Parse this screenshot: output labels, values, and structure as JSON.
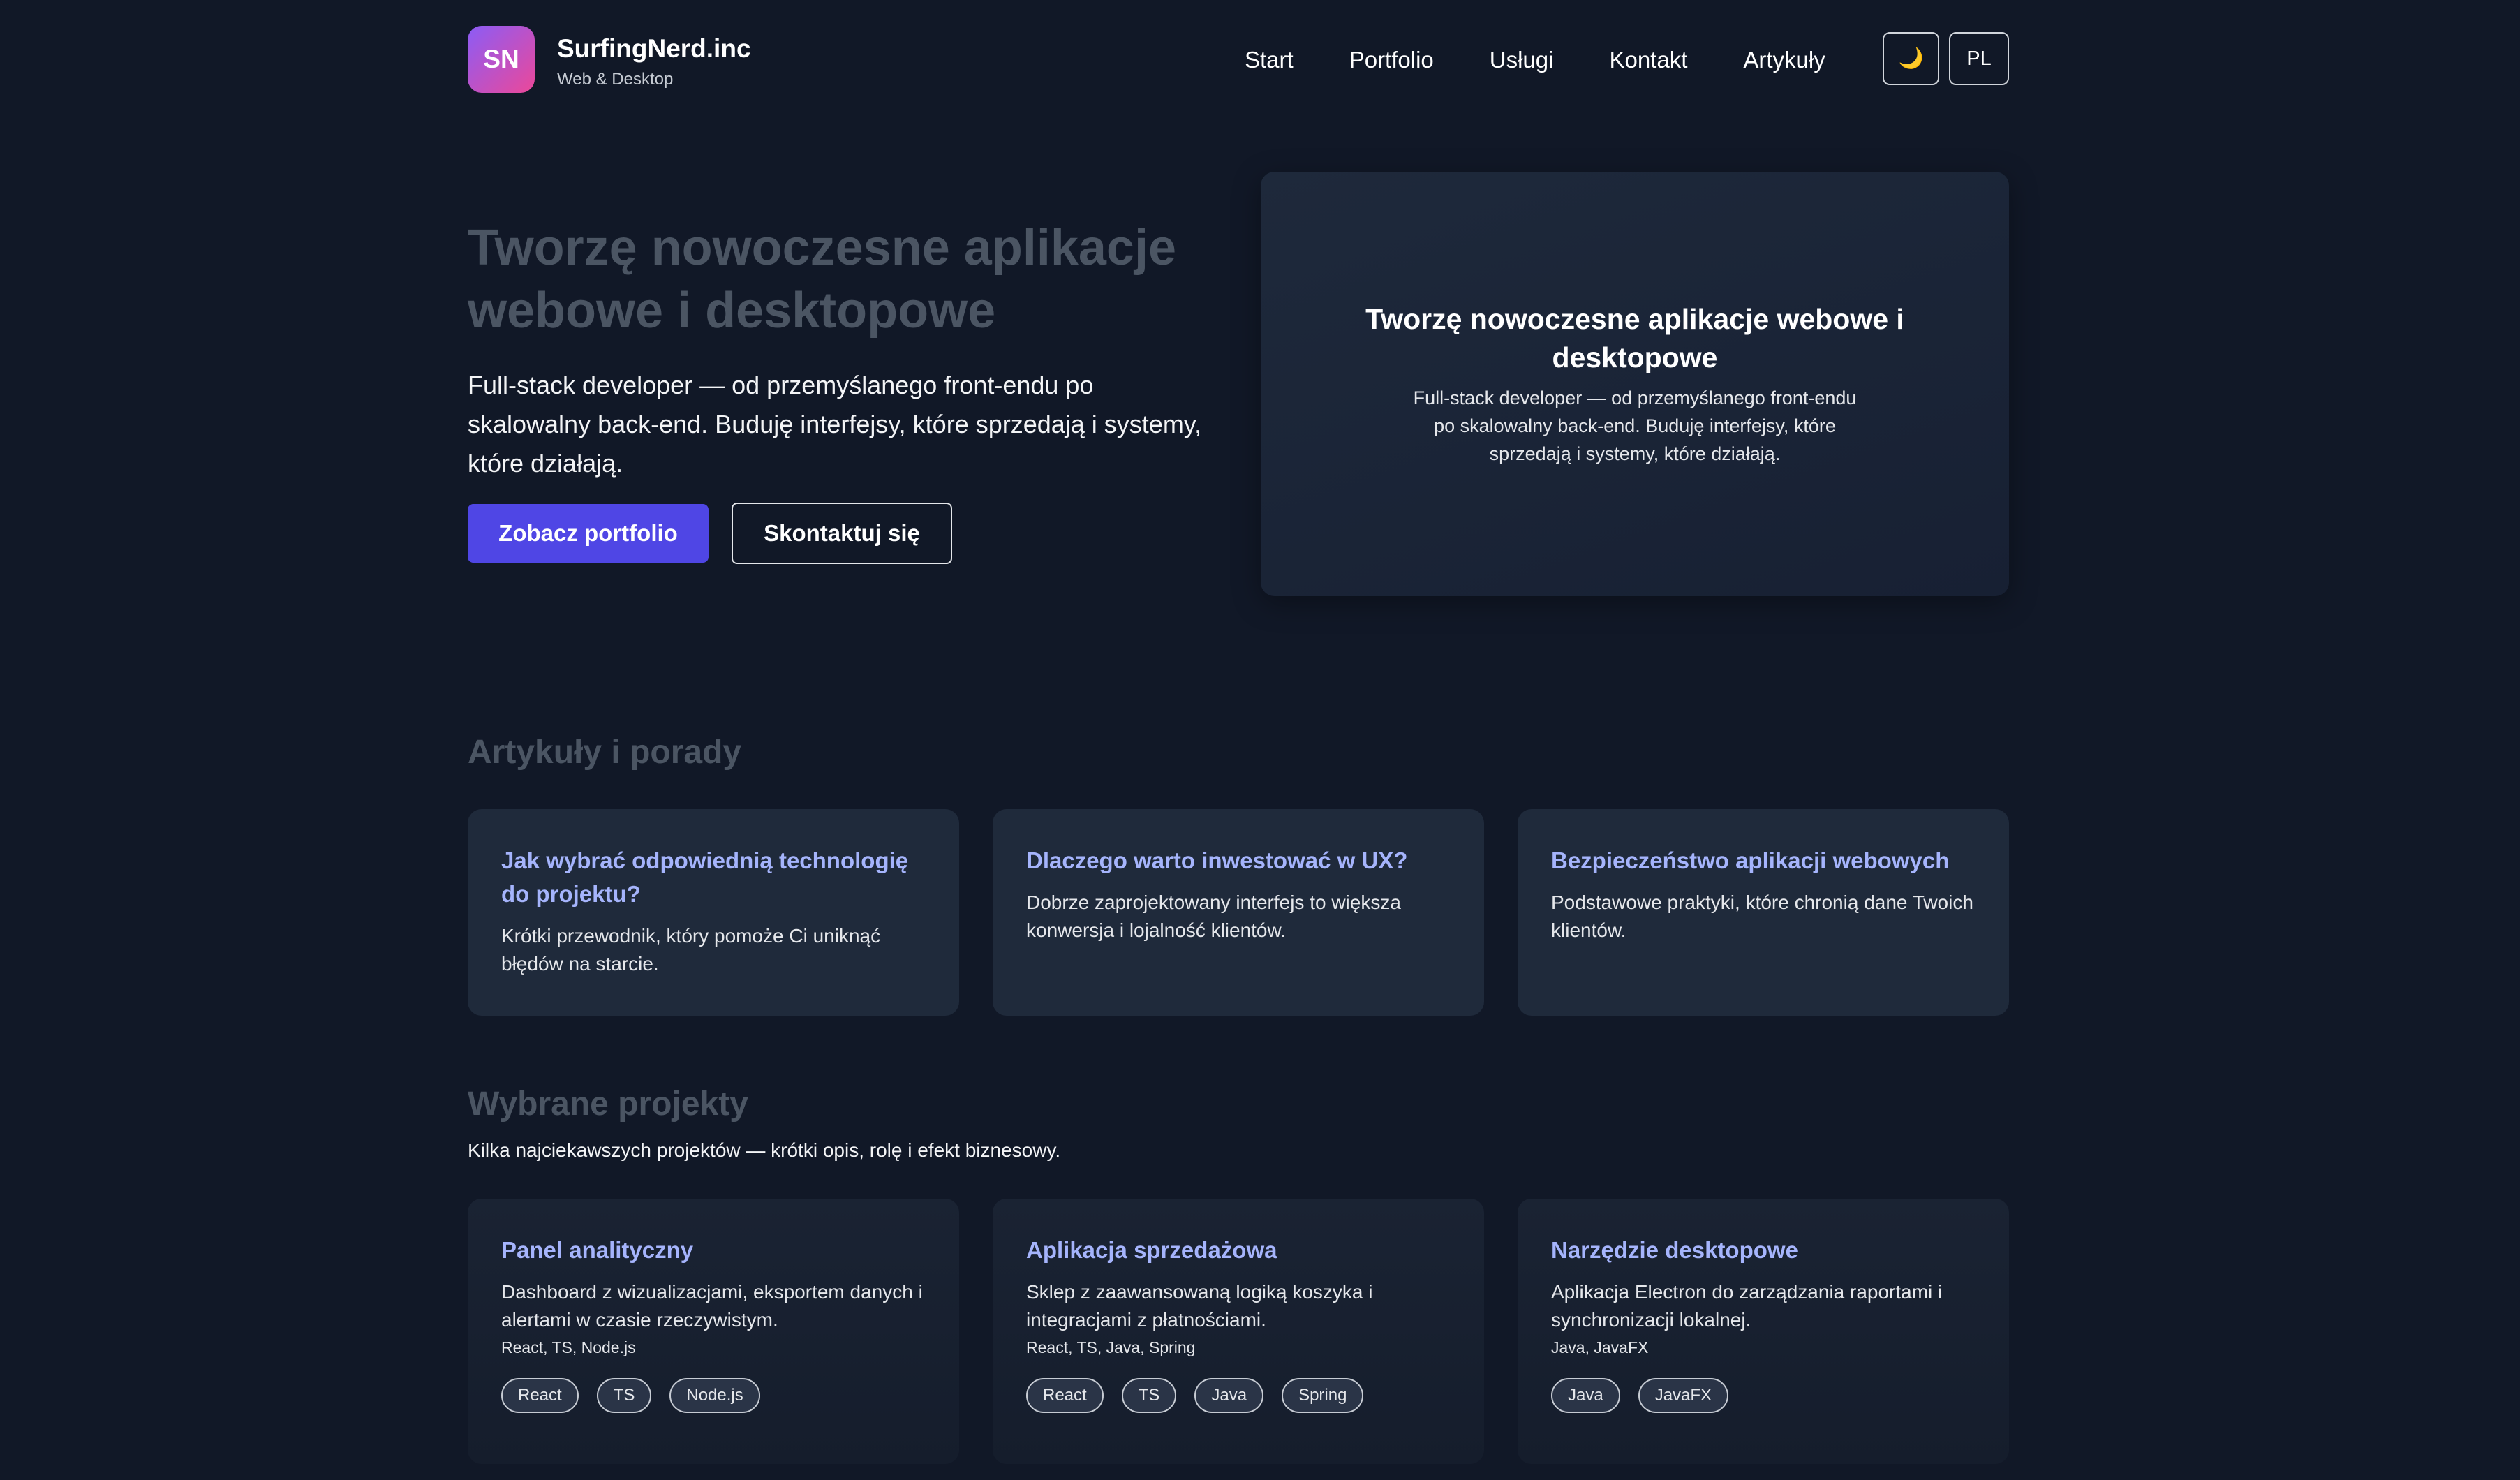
{
  "header": {
    "logo_initials": "SN",
    "brand_name": "SurfingNerd.inc",
    "brand_sub": "Web & Desktop",
    "nav": [
      "Start",
      "Portfolio",
      "Usługi",
      "Kontakt",
      "Artykuły"
    ],
    "theme_icon": "moon-icon",
    "theme_glyph": "🌙",
    "lang_label": "PL"
  },
  "hero": {
    "title": "Tworzę nowoczesne aplikacje webowe i desktopowe",
    "description": "Full-stack developer — od przemyślanego front-endu po skalowalny back-end. Buduję interfejsy, które sprzedają i systemy, które działają.",
    "primary_button": "Zobacz portfolio",
    "secondary_button": "Skontaktuj się",
    "card_title": "Tworzę nowoczesne aplikacje webowe i desktopowe",
    "card_text": "Full-stack developer — od przemyślanego front-endu po skalowalny back-end. Buduję interfejsy, które sprzedają i systemy, które działają."
  },
  "articles": {
    "title": "Artykuły i porady",
    "items": [
      {
        "title": "Jak wybrać odpowiednią technologię do projektu?",
        "text": "Krótki przewodnik, który pomoże Ci uniknąć błędów na starcie."
      },
      {
        "title": "Dlaczego warto inwestować w UX?",
        "text": "Dobrze zaprojektowany interfejs to większa konwersja i lojalność klientów."
      },
      {
        "title": "Bezpieczeństwo aplikacji webowych",
        "text": "Podstawowe praktyki, które chronią dane Twoich klientów."
      }
    ]
  },
  "projects": {
    "title": "Wybrane projekty",
    "subtitle": "Kilka najciekawszych projektów — krótki opis, rolę i efekt biznesowy.",
    "items": [
      {
        "title": "Panel analityczny",
        "text": "Dashboard z wizualizacjami, eksportem danych i alertami w czasie rzeczywistym.",
        "tech": "React, TS, Node.js",
        "tags": [
          "React",
          "TS",
          "Node.js"
        ]
      },
      {
        "title": "Aplikacja sprzedażowa",
        "text": "Sklep z zaawansowaną logiką koszyka i integracjami z płatnościami.",
        "tech": "React, TS, Java, Spring",
        "tags": [
          "React",
          "TS",
          "Java",
          "Spring"
        ]
      },
      {
        "title": "Narzędzie desktopowe",
        "text": "Aplikacja Electron do zarządzania raportami i synchronizacji lokalnej.",
        "tech": "Java, JavaFX",
        "tags": [
          "Java",
          "JavaFX"
        ]
      }
    ]
  }
}
